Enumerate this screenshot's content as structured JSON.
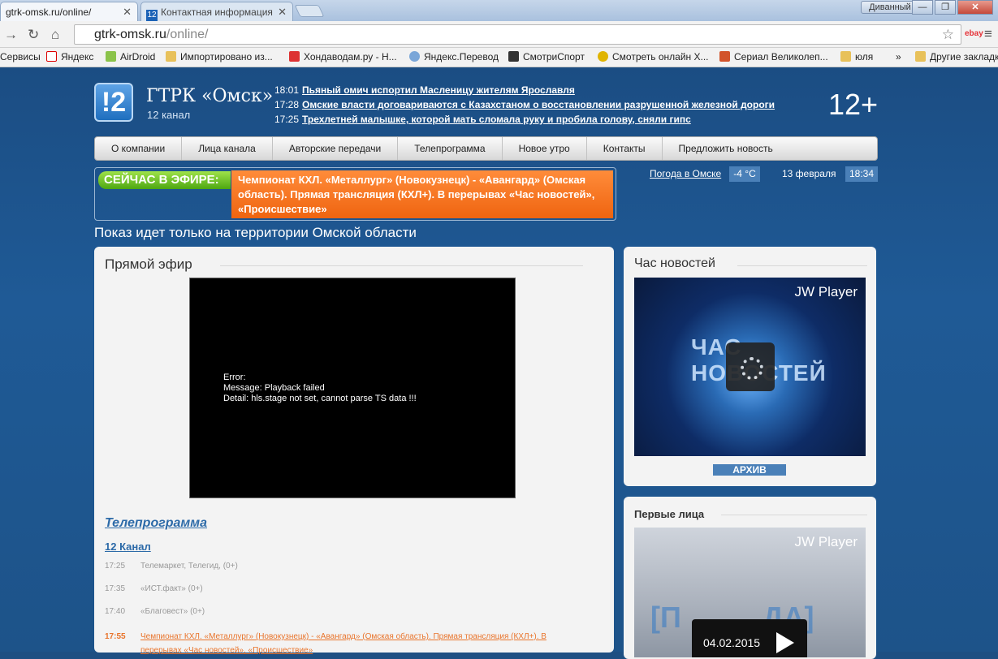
{
  "browser": {
    "tabs": [
      {
        "title": "gtrk-omsk.ru/online/"
      },
      {
        "title": "Контактная информация"
      }
    ],
    "window_label": "Диванный",
    "url_host": "gtrk-omsk.ru",
    "url_path": "/online/",
    "bookmarks": [
      "Сервисы",
      "Яндекс",
      "AirDroid",
      "Импортировано из...",
      "Хондаводам.ру - Н...",
      "Яндекс.Перевод",
      "СмотриСпорт",
      "Смотреть онлайн Х...",
      "Сериал Великолеп...",
      "юля",
      "»",
      "Другие закладки"
    ]
  },
  "header": {
    "logo": "!2",
    "brand": "ГТРК «Омск»",
    "brand_sub": "12 канал",
    "age": "12+",
    "news": [
      {
        "time": "18:01",
        "text": "Пьяный омич испортил Масленицу жителям Ярославля"
      },
      {
        "time": "17:28",
        "text": "Омские власти договариваются с Казахстаном о восстановлении разрушенной железной дороги"
      },
      {
        "time": "17:25",
        "text": "Трехлетней малышке, которой мать сломала руку и пробила голову, сняли гипс"
      }
    ]
  },
  "nav": [
    "О компании",
    "Лица канала",
    "Авторские передачи",
    "Телепрограмма",
    "Новое утро",
    "Контакты",
    "Предложить новость"
  ],
  "onair": {
    "label": "СЕЙЧАС В ЭФИРЕ:",
    "text": "Чемпионат КХЛ. «Металлург» (Новокузнецк) - «Авангард» (Омская область). Прямая трансляция (КХЛ+). В перерывах «Час новостей», «Происшествие»"
  },
  "weather": {
    "label": "Погода в Омске",
    "temp": "-4 °C",
    "date": "13 февраля",
    "time": "18:34"
  },
  "region_notice": "Показ идет только на территории Омской области",
  "live": {
    "title": "Прямой эфир",
    "error_lines": [
      "Error:",
      "Message: Playback failed",
      "Detail: hls.stage not set, cannot parse TS data !!!"
    ],
    "schedule_title": "Телепрограмма",
    "channel": "12 Канал",
    "schedule": [
      {
        "time": "17:25",
        "title": "Телемаркет, Телегид, (0+)"
      },
      {
        "time": "17:35",
        "title": "«ИСТ.факт» (0+)"
      },
      {
        "time": "17:40",
        "title": "«Благовест» (0+)"
      },
      {
        "time": "17:55",
        "title": "Чемпионат КХЛ. «Металлург» (Новокузнецк) - «Авангард» (Омская область). Прямая трансляция (КХЛ+). В перерывах «Час новостей», «Происшествие»"
      }
    ]
  },
  "sidebar": {
    "news_title": "Час новостей",
    "player_brand": "JW Player",
    "video1_text": "ЧАС НОВОСТЕЙ",
    "archive": "АРХИВ",
    "faces_title": "Первые лица",
    "video2_date": "04.02.2015"
  }
}
